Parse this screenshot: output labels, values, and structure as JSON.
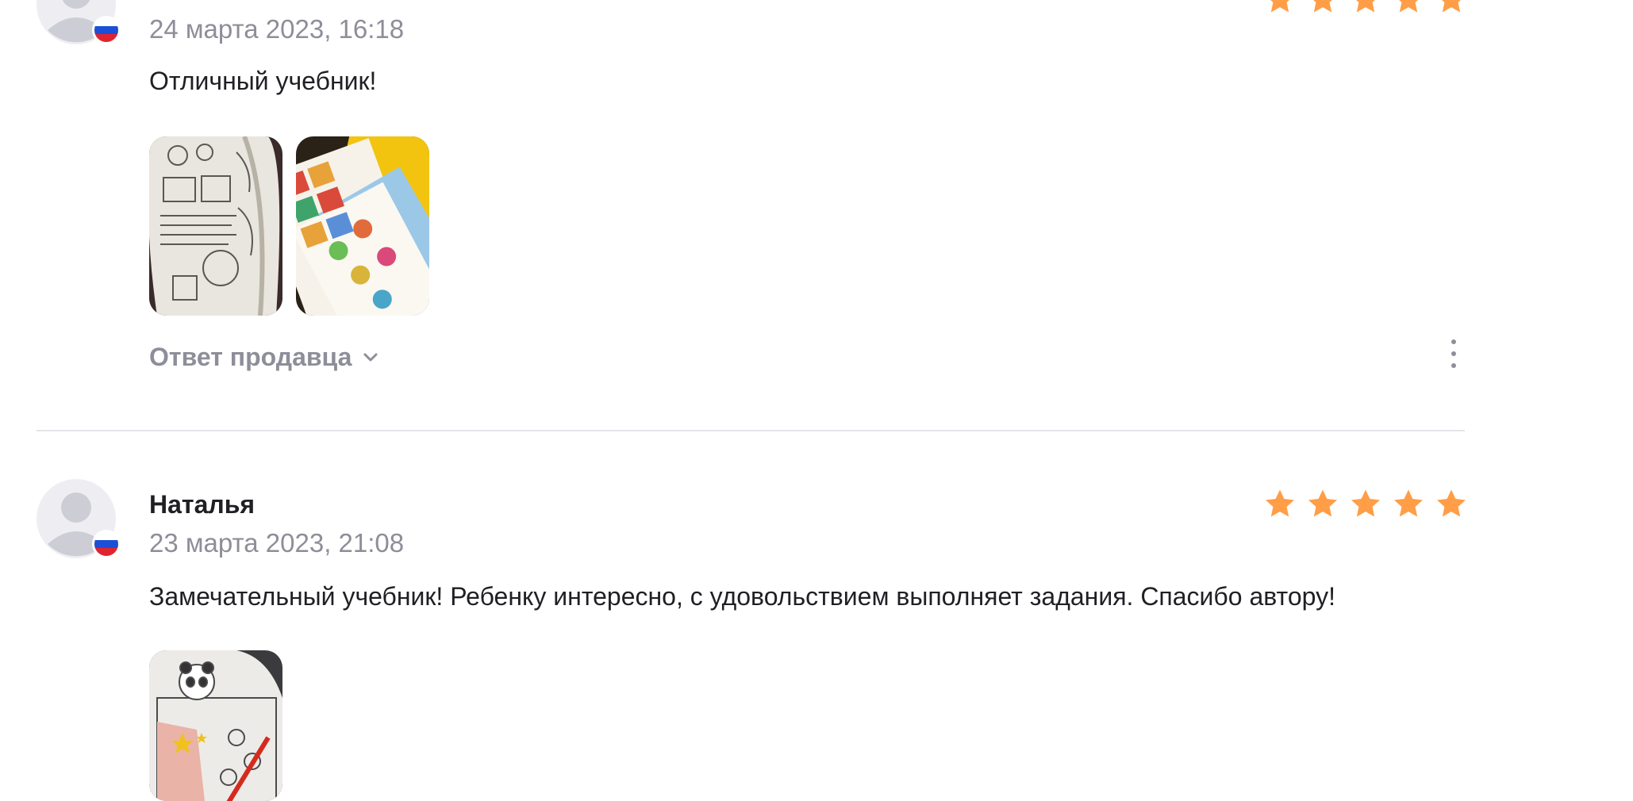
{
  "reviews": [
    {
      "author": "",
      "date": "24 марта 2023, 16:18",
      "rating": 5,
      "text": "Отличный учебник!",
      "photos": [
        "workbook-page-photo",
        "colorful-cards-photo"
      ],
      "seller_reply_label": "Ответ продавца",
      "country_flag": "ru-flag-icon"
    },
    {
      "author": "Наталья",
      "date": "23 марта 2023, 21:08",
      "rating": 5,
      "text": "Замечательный учебник! Ребенку интересно, с удовольствием выполняет задания. Спасибо автору!",
      "photos": [
        "panda-workbook-photo"
      ],
      "country_flag": "ru-flag-icon"
    }
  ],
  "colors": {
    "star": "#ff9e47",
    "muted_text": "#8e8e99",
    "text": "#1f1f24",
    "divider": "#e4e4ea",
    "flag_white": "#ffffff",
    "flag_blue": "#1c4fd8",
    "flag_red": "#e0242f"
  }
}
